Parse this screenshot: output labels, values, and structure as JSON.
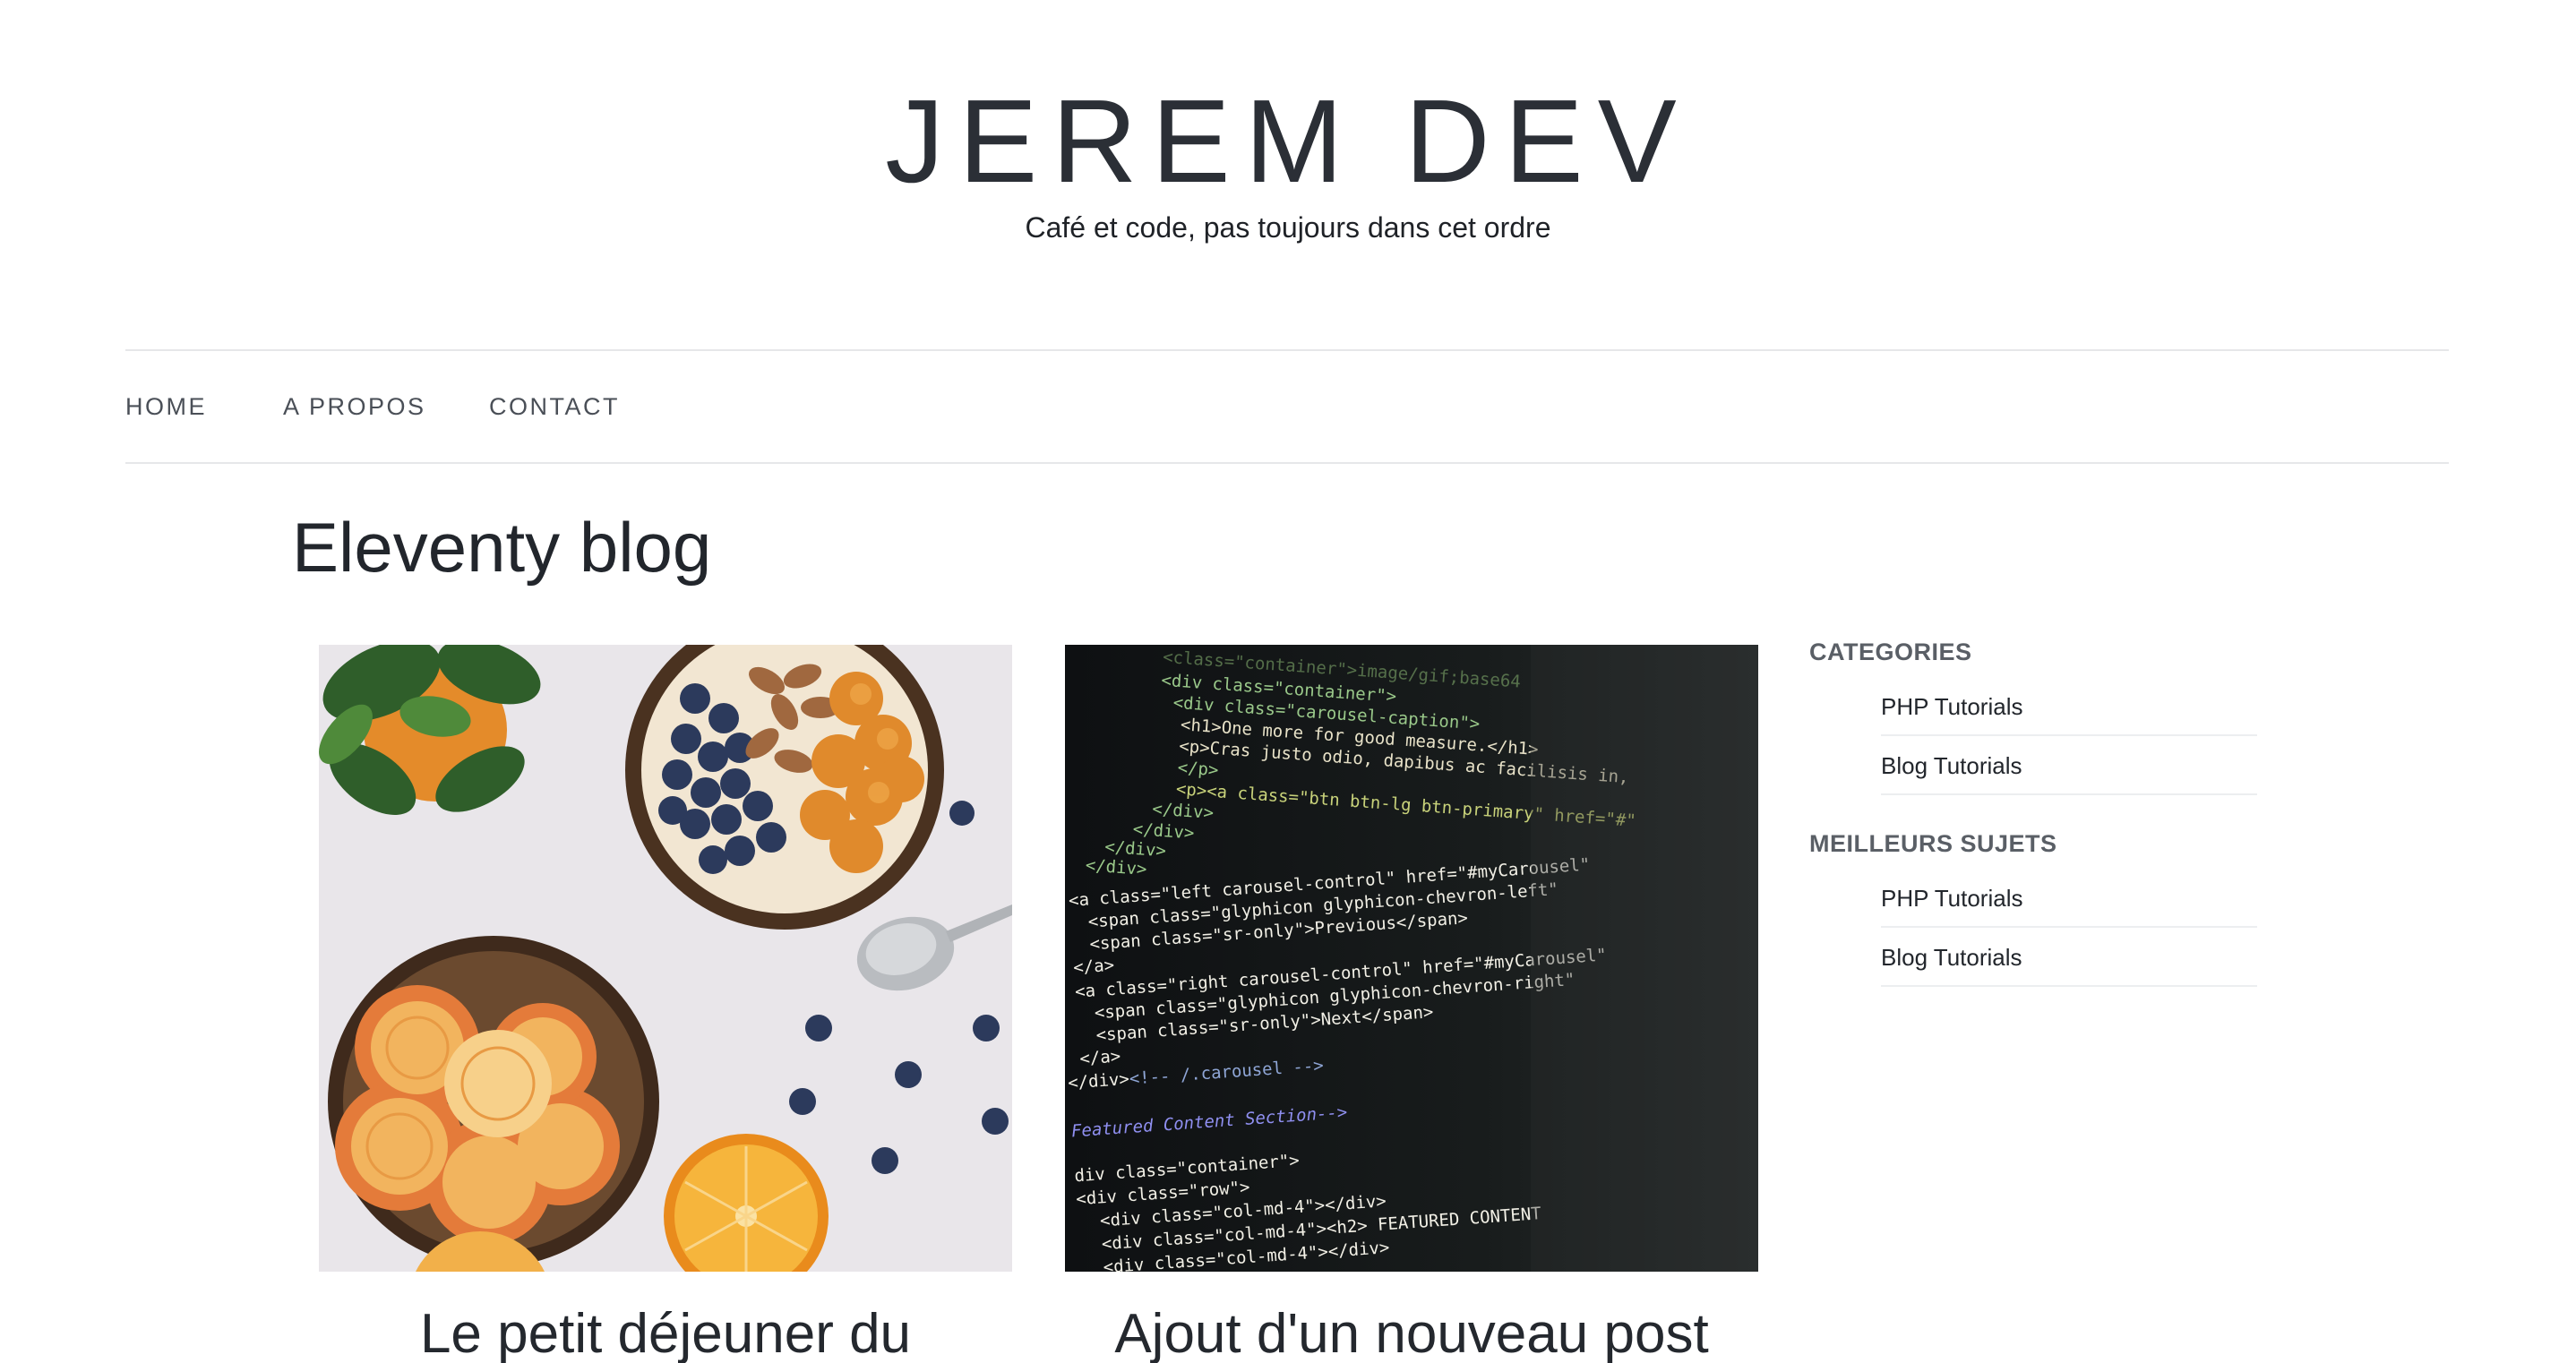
{
  "site": {
    "title": "JEREM DEV",
    "tagline": "Café et code, pas toujours dans cet ordre"
  },
  "nav": {
    "items": [
      {
        "label": "HOME"
      },
      {
        "label": "A PROPOS"
      },
      {
        "label": "CONTACT"
      }
    ]
  },
  "main": {
    "title": "Eleventy blog",
    "posts": [
      {
        "title": "Le petit déjeuner du",
        "image": "breakfast-bowls-photo"
      },
      {
        "title": "Ajout d'un nouveau post",
        "image": "code-editor-photo"
      }
    ]
  },
  "sidebar": {
    "widgets": [
      {
        "title": "CATEGORIES",
        "items": [
          {
            "label": "PHP Tutorials"
          },
          {
            "label": "Blog Tutorials"
          }
        ]
      },
      {
        "title": "MEILLEURS SUJETS",
        "items": [
          {
            "label": "PHP Tutorials"
          },
          {
            "label": "Blog Tutorials"
          }
        ]
      }
    ]
  },
  "colors": {
    "text": "#2b2f36",
    "divider": "#e6e7e9",
    "muted": "#5a5f66"
  }
}
